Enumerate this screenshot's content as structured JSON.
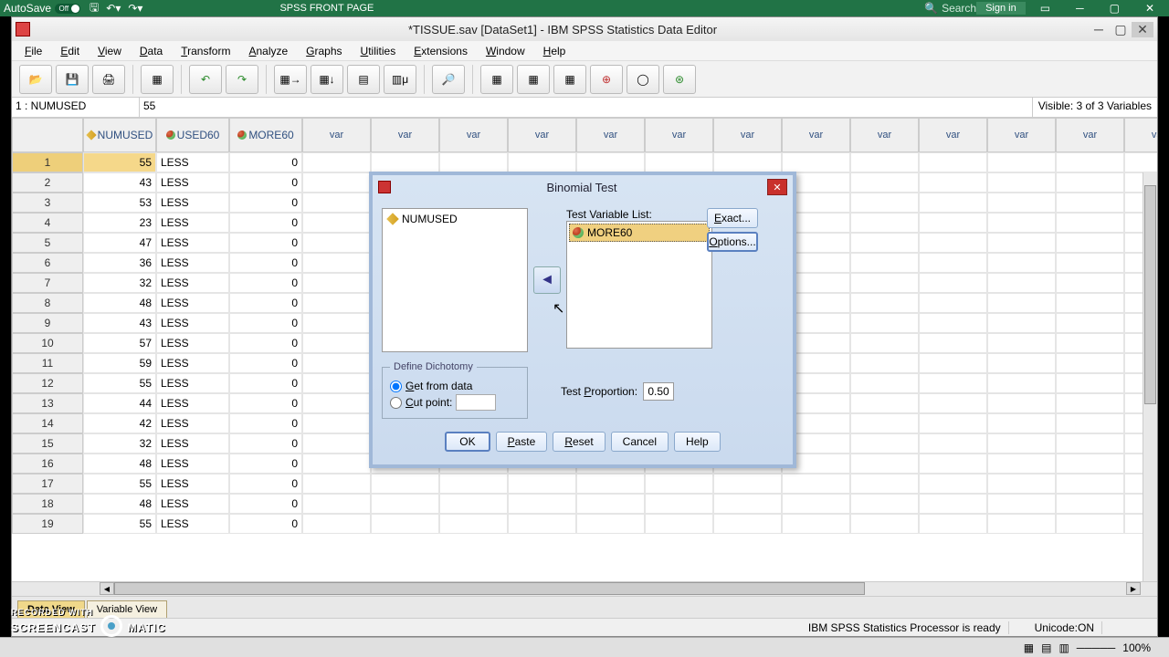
{
  "excel": {
    "autosave": "AutoSave",
    "autosave_state": "Off",
    "doc_title": "SPSS FRONT PAGE",
    "search": "Search",
    "signin": "Sign in"
  },
  "spss": {
    "title": "*TISSUE.sav [DataSet1] - IBM SPSS Statistics Data Editor",
    "menu": [
      "File",
      "Edit",
      "View",
      "Data",
      "Transform",
      "Analyze",
      "Graphs",
      "Utilities",
      "Extensions",
      "Window",
      "Help"
    ],
    "cell_ref": "1 : NUMUSED",
    "cell_val": "55",
    "visible": "Visible: 3 of 3 Variables",
    "headers": [
      "NUMUSED",
      "USED60",
      "MORE60",
      "var",
      "var",
      "var",
      "var",
      "var",
      "var",
      "var",
      "var",
      "var",
      "var",
      "var",
      "var",
      "var"
    ],
    "rows": [
      {
        "n": 1,
        "v": [
          55,
          "LESS",
          0
        ]
      },
      {
        "n": 2,
        "v": [
          43,
          "LESS",
          0
        ]
      },
      {
        "n": 3,
        "v": [
          53,
          "LESS",
          0
        ]
      },
      {
        "n": 4,
        "v": [
          23,
          "LESS",
          0
        ]
      },
      {
        "n": 5,
        "v": [
          47,
          "LESS",
          0
        ]
      },
      {
        "n": 6,
        "v": [
          36,
          "LESS",
          0
        ]
      },
      {
        "n": 7,
        "v": [
          32,
          "LESS",
          0
        ]
      },
      {
        "n": 8,
        "v": [
          48,
          "LESS",
          0
        ]
      },
      {
        "n": 9,
        "v": [
          43,
          "LESS",
          0
        ]
      },
      {
        "n": 10,
        "v": [
          57,
          "LESS",
          0
        ]
      },
      {
        "n": 11,
        "v": [
          59,
          "LESS",
          0
        ]
      },
      {
        "n": 12,
        "v": [
          55,
          "LESS",
          0
        ]
      },
      {
        "n": 13,
        "v": [
          44,
          "LESS",
          0
        ]
      },
      {
        "n": 14,
        "v": [
          42,
          "LESS",
          0
        ]
      },
      {
        "n": 15,
        "v": [
          32,
          "LESS",
          0
        ]
      },
      {
        "n": 16,
        "v": [
          48,
          "LESS",
          0
        ]
      },
      {
        "n": 17,
        "v": [
          55,
          "LESS",
          0
        ]
      },
      {
        "n": 18,
        "v": [
          48,
          "LESS",
          0
        ]
      },
      {
        "n": 19,
        "v": [
          55,
          "LESS",
          0
        ]
      }
    ],
    "tabs": {
      "data": "Data View",
      "var": "Variable View"
    },
    "status": {
      "proc": "IBM SPSS Statistics Processor is ready",
      "unicode": "Unicode:ON"
    }
  },
  "dialog": {
    "title": "Binomial Test",
    "left_var": "NUMUSED",
    "test_list_label": "Test Variable List:",
    "test_var": "MORE60",
    "exact": "Exact...",
    "options": "Options...",
    "define": "Define Dichotomy",
    "getdata": "Get from data",
    "cutpoint": "Cut point:",
    "test_prop_label": "Test Proportion:",
    "test_prop_val": "0.50",
    "ok": "OK",
    "paste": "Paste",
    "reset": "Reset",
    "cancel": "Cancel",
    "help": "Help"
  },
  "bottom": {
    "zoom": "100%"
  },
  "watermark": {
    "rec": "RECORDED WITH",
    "brand1": "SCREENCAST",
    "brand2": "MATIC"
  }
}
